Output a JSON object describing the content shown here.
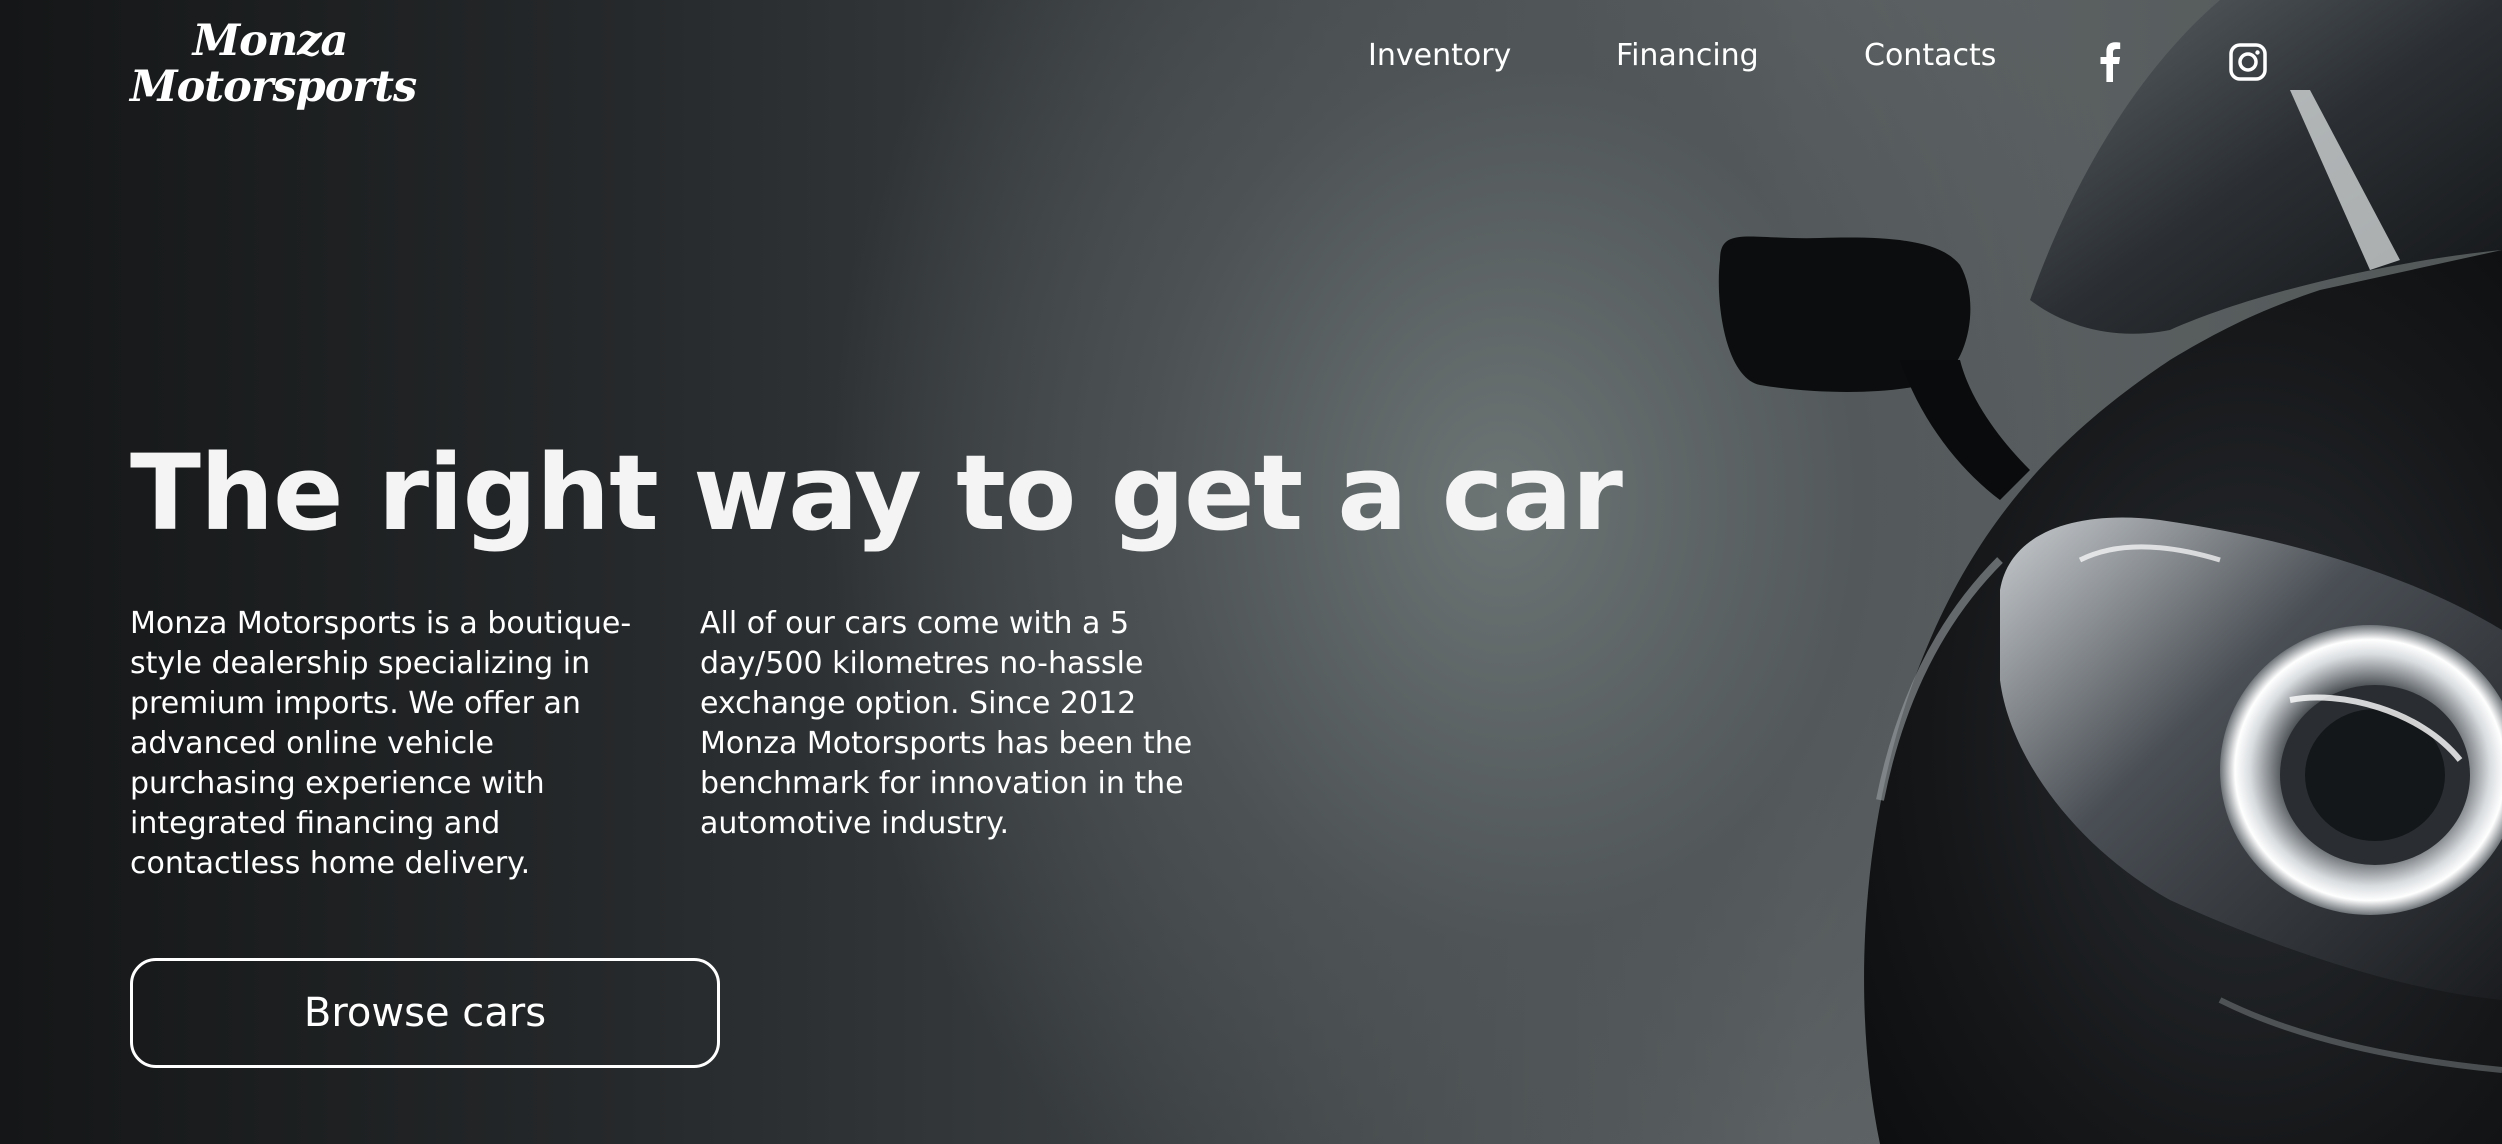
{
  "brand": {
    "logo_line1": "Monza",
    "logo_line2": "Motorsports"
  },
  "nav": {
    "items": [
      {
        "label": "Inventory"
      },
      {
        "label": "Financing"
      },
      {
        "label": "Contacts"
      }
    ],
    "social": [
      {
        "icon": "facebook-icon"
      },
      {
        "icon": "instagram-icon"
      }
    ]
  },
  "hero": {
    "headline": "The right way to get a car",
    "paragraph_1": "Monza Motorsports is a boutique-style dealership specializing in premium imports. We offer an advanced online vehicle purchasing experience with integrated financing and contactless home delivery.",
    "paragraph_2": "All of our cars come with a 5 day/500 kilometres no-hassle exchange option. Since 2012 Monza Motorsports has been the benchmark for innovation in the automotive industry.",
    "cta_label": "Browse cars"
  },
  "colors": {
    "text": "#ffffff",
    "background_dark": "#141617",
    "background_mid": "#5f6566"
  }
}
